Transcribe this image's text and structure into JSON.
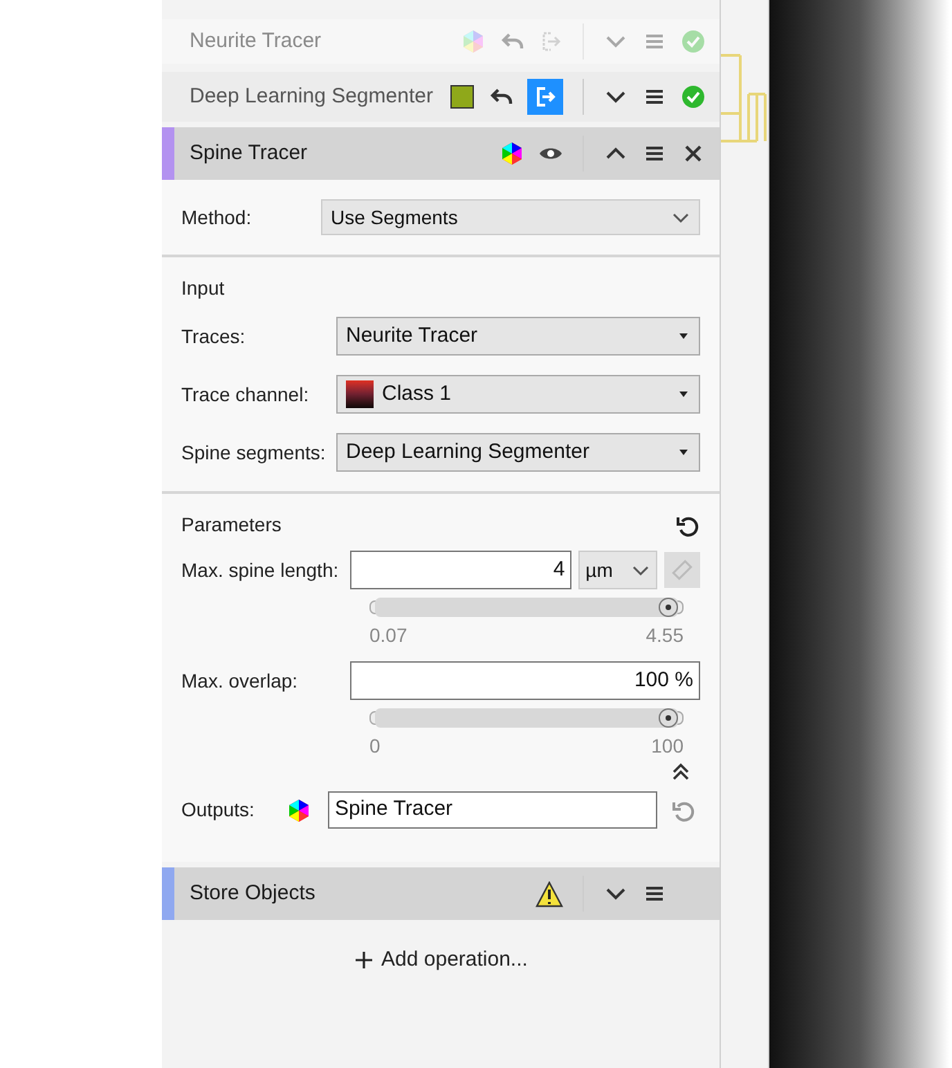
{
  "operations": [
    {
      "title": "Neurite Tracer",
      "kind": "faded"
    },
    {
      "title": "Deep Learning Segmenter",
      "kind": "plain"
    },
    {
      "title": "Spine Tracer",
      "kind": "expanded",
      "color": "#b392f0"
    },
    {
      "title": "Store Objects",
      "kind": "warning",
      "color": "#8fa8f0"
    }
  ],
  "method": {
    "label": "Method:",
    "value": "Use Segments"
  },
  "input": {
    "title": "Input",
    "rows": [
      {
        "label": "Traces:",
        "value": "Neurite Tracer",
        "kind": "plain"
      },
      {
        "label": "Trace channel:",
        "value": "Class 1",
        "kind": "channel"
      },
      {
        "label": "Spine segments:",
        "value": "Deep Learning Segmenter",
        "kind": "plain"
      }
    ]
  },
  "parameters": {
    "title": "Parameters",
    "items": [
      {
        "label": "Max. spine length:",
        "value": "4",
        "unit": "µm",
        "min": "0.07",
        "max": "4.55",
        "level": 1,
        "kind": "unit"
      },
      {
        "label": "Max. overlap:",
        "value": "100 %",
        "min": "0",
        "max": "100",
        "level": 1,
        "kind": "plain"
      }
    ]
  },
  "outputs": {
    "label": "Outputs:",
    "value": "Spine Tracer"
  },
  "add_operation": "Add operation..."
}
